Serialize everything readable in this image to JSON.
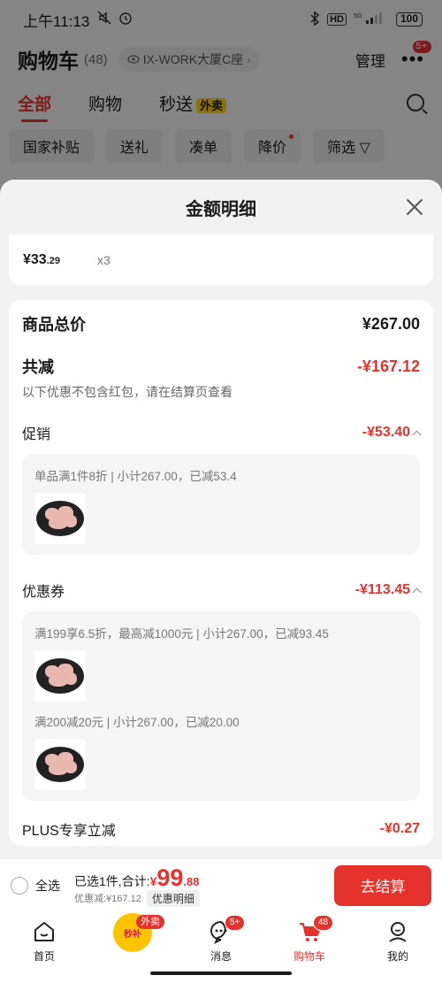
{
  "status_bar": {
    "time": "上午11:13",
    "battery": "100"
  },
  "cart": {
    "title": "购物车",
    "count": "(48)",
    "location": "IX-WORK大厦C座",
    "manage_label": "管理",
    "more_badge": "5+",
    "tabs": [
      {
        "label": "全部"
      },
      {
        "label": "购物"
      },
      {
        "label": "秒送"
      }
    ],
    "waimai_tag": "外卖",
    "filters": [
      {
        "label": "国家补贴"
      },
      {
        "label": "送礼"
      },
      {
        "label": "凑单"
      },
      {
        "label": "降价"
      },
      {
        "label": "筛选"
      }
    ],
    "filter_icon": "▽"
  },
  "modal": {
    "title": "金额明细",
    "top_item": {
      "price_main": "¥33",
      "price_cents": ".29",
      "qty": "x3"
    },
    "total_label": "商品总价",
    "total_value": "¥267.00",
    "reduce_label": "共减",
    "reduce_value": "-¥167.12",
    "note": "以下优惠不包含红包，请在结算页查看",
    "promo": {
      "label": "促销",
      "value": "-¥53.40",
      "details": [
        "单品满1件8折 | 小计267.00，已减53.4"
      ]
    },
    "coupon": {
      "label": "优惠券",
      "value": "-¥113.45",
      "details": [
        "满199享6.5折，最高减1000元 | 小计267.00，已减93.45",
        "满200减20元 | 小计267.00，已减20.00"
      ]
    },
    "plus_label": "PLUS专享立减",
    "plus_value": "-¥0.27"
  },
  "checkout": {
    "select_all": "全选",
    "selected_text": "已选1件,合计:",
    "currency": "¥",
    "price_int": "99",
    "price_cents": ".88",
    "discount_text": "优惠减:¥167.12",
    "detail_button": "优惠明细",
    "checkout_button": "去结算"
  },
  "nav": {
    "items": [
      {
        "label": "首页"
      },
      {
        "label": ""
      },
      {
        "label": "消息"
      },
      {
        "label": "购物车"
      },
      {
        "label": "我的"
      }
    ],
    "promo_tag": "外卖",
    "promo_text": "秒补",
    "message_badge": "5+",
    "cart_badge": "48"
  },
  "colors": {
    "accent": "#e5322d",
    "tag_yellow": "#ffd400"
  }
}
